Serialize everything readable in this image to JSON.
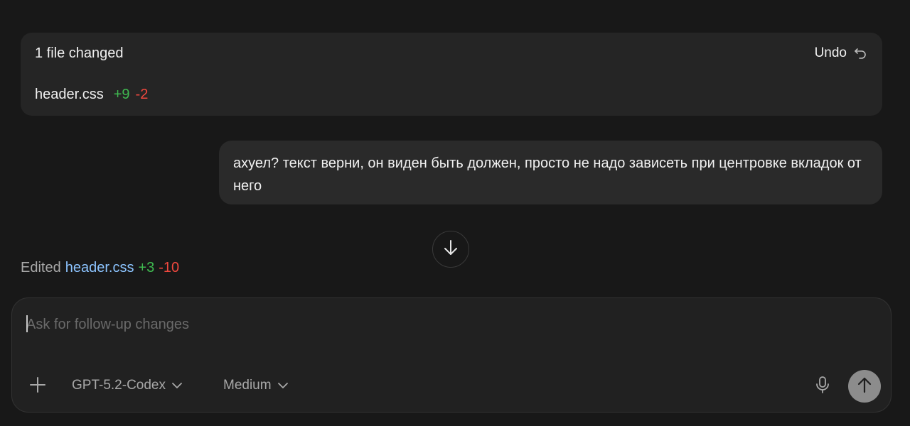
{
  "changes": {
    "title": "1 file changed",
    "undo_label": "Undo",
    "undo_icon": "undo-icon",
    "file": {
      "name": "header.css",
      "added": "+9",
      "removed": "-2"
    }
  },
  "user_message": {
    "text": "ахуел? текст верни, он виден быть должен, просто не надо зависеть при центровке вкладок от него"
  },
  "scroll_down": {
    "icon": "arrow-down-icon"
  },
  "edited": {
    "label": "Edited",
    "file": "header.css",
    "added": "+3",
    "removed": "-10"
  },
  "composer": {
    "placeholder": "Ask for follow-up changes",
    "value": "",
    "add_icon": "plus-icon",
    "model": "GPT-5.2-Codex",
    "effort": "Medium",
    "mic_icon": "microphone-icon",
    "send_icon": "arrow-up-icon"
  },
  "colors": {
    "background": "#181818",
    "card": "#252525",
    "added": "#3fb950",
    "removed": "#f0483e",
    "link": "#8cc4ff",
    "send_button": "#8c8c8c"
  }
}
